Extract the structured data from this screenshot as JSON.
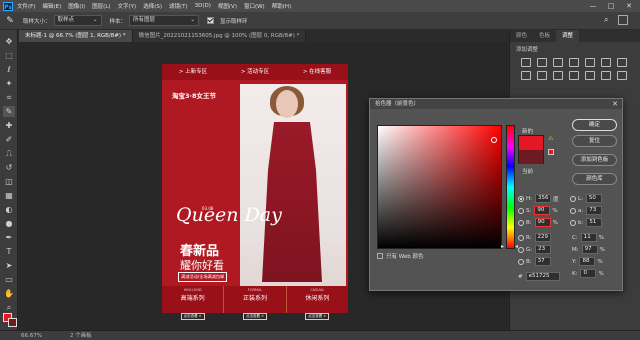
{
  "menubar": {
    "logo": "Ps",
    "items": [
      "文件(F)",
      "编辑(E)",
      "图像(I)",
      "图层(L)",
      "文字(Y)",
      "选择(S)",
      "滤镜(T)",
      "3D(D)",
      "视图(V)",
      "窗口(W)",
      "帮助(H)"
    ],
    "minimize": "—",
    "maximize": "□",
    "close": "✕"
  },
  "options": {
    "sample_size_label": "取样大小：",
    "sample_size_value": "取样点",
    "sample_label": "样本：",
    "sample_value": "所有图层",
    "show_ring_label": "显示取样环"
  },
  "tabs": [
    "未标题-1 @ 66.7% (图层 1, RGB/8#) *",
    "微信图片_20221021153605.jpg @ 100% (图层 0, RGB/8#) *"
  ],
  "poster": {
    "nav": [
      "> 上新专区",
      "> 活动专区",
      "> 在线客服"
    ],
    "brand": "淘宝3·8女王节",
    "date": "03.08",
    "queen": "Queen Day",
    "sale1": "春新品",
    "sale2": "耀你好看",
    "promo": "满减活动/全场满减包邮",
    "period": "活动时间:3.7~3.14",
    "arrows": ">>>",
    "series": [
      {
        "en": "HIGH-END",
        "cn": "高端系列",
        "more": "点击查看 >"
      },
      {
        "en": "FORMAL",
        "cn": "正装系列",
        "more": "点击查看 >"
      },
      {
        "en": "CASUAL",
        "cn": "休闲系列",
        "more": "点击查看 >"
      }
    ]
  },
  "dock": {
    "tabs": [
      "颜色",
      "色板",
      "调整"
    ],
    "sub": "添加调整"
  },
  "picker": {
    "title": "拾色器（前景色）",
    "new_label": "新的",
    "current_label": "当前",
    "ok": "确定",
    "cancel": "复位",
    "add_swatch": "添加到色板",
    "libraries": "颜色库",
    "web_only": "只有 Web 颜色",
    "new_color": "#e51725",
    "current_color": "#6d1a22",
    "fields": {
      "H": "356",
      "S": "90",
      "B": "90",
      "R": "229",
      "G": "23",
      "Bl": "37",
      "L": "50",
      "a": "73",
      "b": "51",
      "C": "11",
      "M": "97",
      "Y": "88",
      "K": "0",
      "hex": "e51725"
    },
    "units": {
      "deg": "度",
      "pct": "%"
    }
  },
  "status": {
    "zoom": "66.67%",
    "doc": "2 个画板"
  }
}
